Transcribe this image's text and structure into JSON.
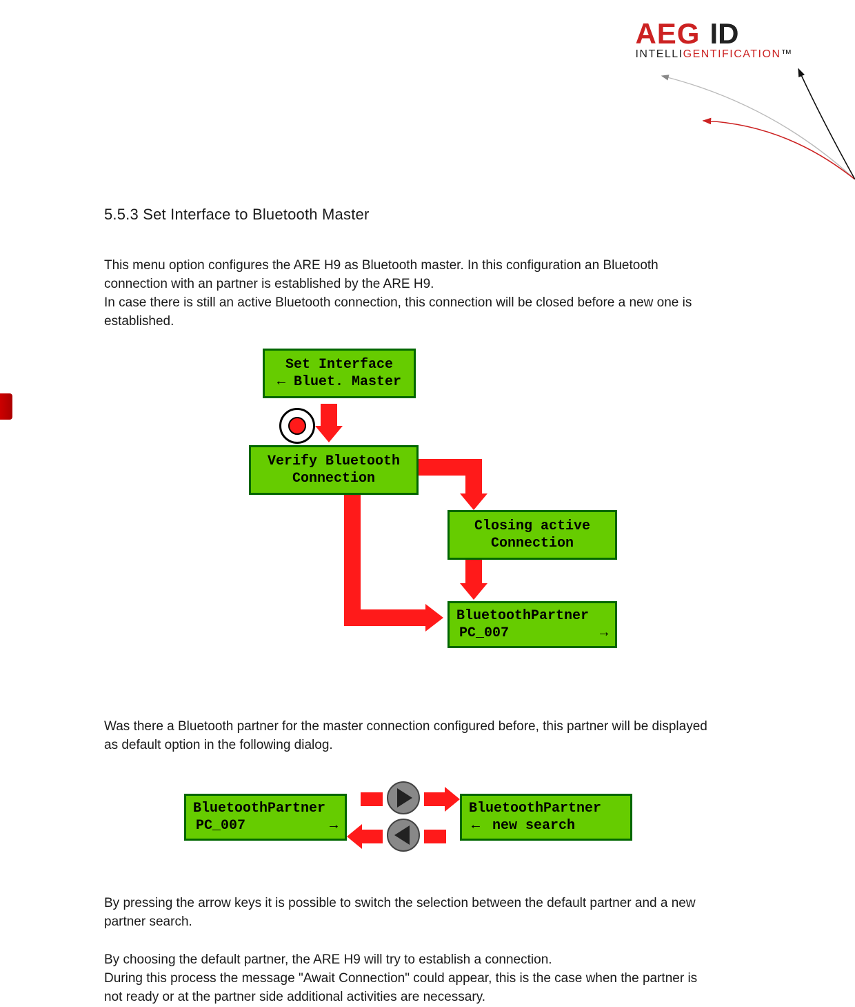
{
  "logo": {
    "brand": "AEG",
    "id": "ID",
    "tagline_p1": "INTELLI",
    "tagline_p2": "GENT",
    "tagline_p3": "IFICATION",
    "tagline_tm": "™"
  },
  "heading": "5.5.3  Set Interface to Bluetooth Master",
  "para1": "This menu option configures the ARE H9 as Bluetooth master. In this configuration an Bluetooth connection with an partner is established by the ARE H9.",
  "para2": "In case there is still an active Bluetooth connection, this connection will be closed before a new one is established.",
  "box_set_interface_l1": "Set Interface",
  "box_set_interface_l2": "←  Bluet. Master",
  "box_verify_l1": "Verify Bluetooth",
  "box_verify_l2": "Connection",
  "box_closing_l1": "Closing active",
  "box_closing_l2": "Connection",
  "box_bt_partner_l1": "BluetoothPartner",
  "box_bt_partner_l2": "PC_007",
  "arrow_right": "→",
  "arrow_left": "←",
  "para3": "Was there a Bluetooth partner for the master connection configured before, this partner will be displayed as default option in the following dialog.",
  "box_newsearch_l1": "BluetoothPartner",
  "box_newsearch_l2a": "←",
  "box_newsearch_l2b": "new search",
  "para4": "By pressing the arrow keys it is possible to switch the selection between the default partner and a new partner search.",
  "para5": "By choosing the default partner, the ARE H9 will try to establish a connection.",
  "para6": "During this process the message \"Await Connection\" could appear, this is the case when the partner is not ready or at the partner side additional activities are necessary."
}
